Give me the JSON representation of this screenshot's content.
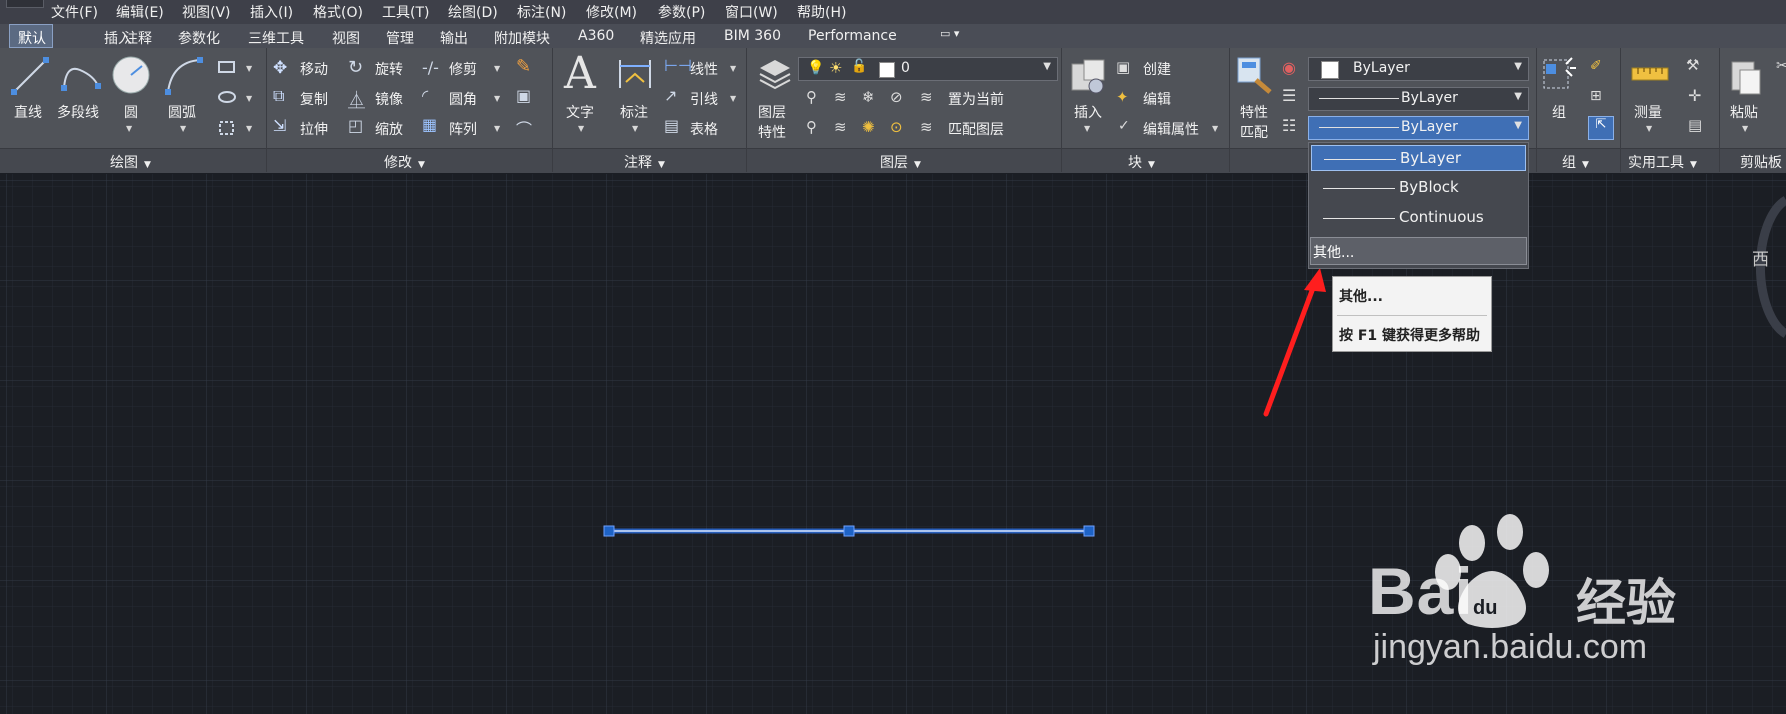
{
  "menu": {
    "items": [
      "文件(F)",
      "编辑(E)",
      "视图(V)",
      "插入(I)",
      "格式(O)",
      "工具(T)",
      "绘图(D)",
      "标注(N)",
      "修改(M)",
      "参数(P)",
      "窗口(W)",
      "帮助(H)"
    ]
  },
  "ribbon_tabs": {
    "items": [
      "默认",
      "插入",
      "注释",
      "参数化",
      "三维工具",
      "视图",
      "管理",
      "输出",
      "附加模块",
      "A360",
      "精选应用",
      "BIM 360",
      "Performance"
    ],
    "active": "默认"
  },
  "panels": {
    "draw": {
      "title": "绘图",
      "line": "直线",
      "polyline": "多段线",
      "circle": "圆",
      "arc": "圆弧"
    },
    "modify": {
      "title": "修改",
      "move": "移动",
      "rotate": "旋转",
      "trim": "修剪",
      "copy": "复制",
      "mirror": "镜像",
      "fillet": "圆角",
      "stretch": "拉伸",
      "scale": "缩放",
      "array": "阵列"
    },
    "annotation": {
      "title": "注释",
      "text": "文字",
      "dimension": "标注",
      "linear": "线性",
      "leader": "引线",
      "table": "表格"
    },
    "layers": {
      "title": "图层",
      "layer_props_line1": "图层",
      "layer_props_line2": "特性",
      "current_layer": "0",
      "set_current": "置为当前",
      "match_layer": "匹配图层"
    },
    "block": {
      "title": "块",
      "insert": "插入",
      "create": "创建",
      "edit": "编辑",
      "edit_attributes": "编辑属性"
    },
    "properties": {
      "match_line1": "特性",
      "match_line2": "匹配",
      "color": "ByLayer",
      "lineweight": "ByLayer",
      "linetype": "ByLayer"
    },
    "groups": {
      "title": "组",
      "group": "组"
    },
    "utilities": {
      "title": "实用工具",
      "measure": "测量"
    },
    "clipboard": {
      "title": "剪贴板",
      "paste": "粘贴"
    }
  },
  "linetype_dropdown": {
    "items": [
      "ByLayer",
      "ByBlock",
      "Continuous"
    ],
    "selected": "ByLayer",
    "other": "其他..."
  },
  "tooltip": {
    "title": "其他...",
    "help": "按 F1 键获得更多帮助"
  },
  "viewcube": {
    "west": "西"
  },
  "watermark": {
    "brand": "Bai",
    "brand_cn": "经验",
    "paw_text": "du",
    "url": "jingyan.baidu.com"
  },
  "colors": {
    "selection_blue": "#1e63c6",
    "annotation_red": "#ff1e1e",
    "canvas": "#1b1e24"
  }
}
